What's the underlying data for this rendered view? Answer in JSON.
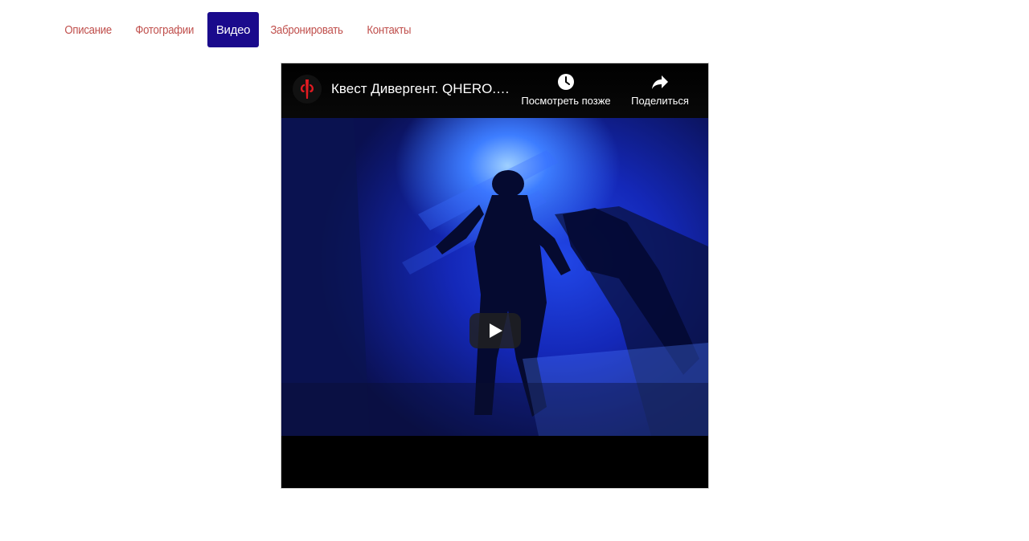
{
  "tabs": [
    {
      "label": "Описание",
      "active": false
    },
    {
      "label": "Фотографии",
      "active": false
    },
    {
      "label": "Видео",
      "active": true
    },
    {
      "label": "Забронировать",
      "active": false
    },
    {
      "label": "Контакты",
      "active": false
    }
  ],
  "player": {
    "title": "Квест Дивергент. QHERO. Страх.",
    "watch_later_label": "Посмотреть позже",
    "share_label": "Поделиться",
    "icons": {
      "channel": "channel-logo-icon",
      "watch_later": "clock-icon",
      "share": "share-arrow-icon",
      "play": "play-icon"
    }
  },
  "colors": {
    "tab_text": "#c0504d",
    "tab_active_bg": "#1a0a8c",
    "tab_active_text": "#ffffff",
    "logo_red": "#e21b22"
  }
}
